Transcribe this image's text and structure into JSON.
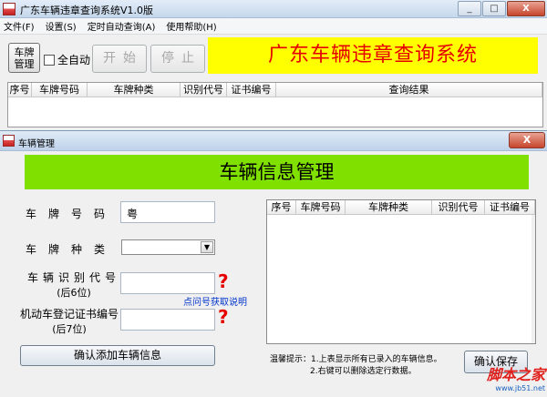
{
  "main_window": {
    "title": "广东车辆违章查询系统V1.0版",
    "controls": {
      "minimize": "_",
      "maximize": "□",
      "close": "X"
    }
  },
  "menu": [
    "文件(F)",
    "设置(S)",
    "定时自动查询(A)",
    "使用帮助(H)"
  ],
  "toolbar": {
    "vehicle_mgmt_line1": "车牌",
    "vehicle_mgmt_line2": "管理",
    "auto_checkbox": "全自动",
    "auto_checked": false,
    "start": "开始",
    "stop": "停止",
    "banner": "广东车辆违章查询系统",
    "banner_bg": "#ffff00",
    "banner_fg": "#e60000"
  },
  "result_table": {
    "columns": [
      "序号",
      "车牌号码",
      "车牌种类",
      "识别代号",
      "证书编号",
      "查询结果"
    ]
  },
  "dialog": {
    "title": "车辆管理",
    "close": "X",
    "banner": "车辆信息管理",
    "banner_bg": "#80e000",
    "plate_label": "车牌号码",
    "plate_value": "粤",
    "type_label": "车牌种类",
    "type_value": "",
    "vin_label": "车辆识别代号",
    "vin_sub": "(后6位)",
    "vin_value": "",
    "cert_label": "机动车登记证书编号",
    "cert_sub": "(后7位)",
    "cert_value": "",
    "help_icon": "?",
    "help_link": "点问号获取说明",
    "add_button": "确认添加车辆信息",
    "list_columns": [
      "序号",
      "车牌号码",
      "车牌种类",
      "识别代号",
      "证书编号"
    ],
    "tips_line1": "温馨提示：1.上表显示所有已录入的车辆信息。",
    "tips_line2": "2.右键可以删除选定行数据。",
    "save_button": "确认保存"
  },
  "watermark": {
    "brand": "脚本之家",
    "url": "www.jb51.net"
  }
}
